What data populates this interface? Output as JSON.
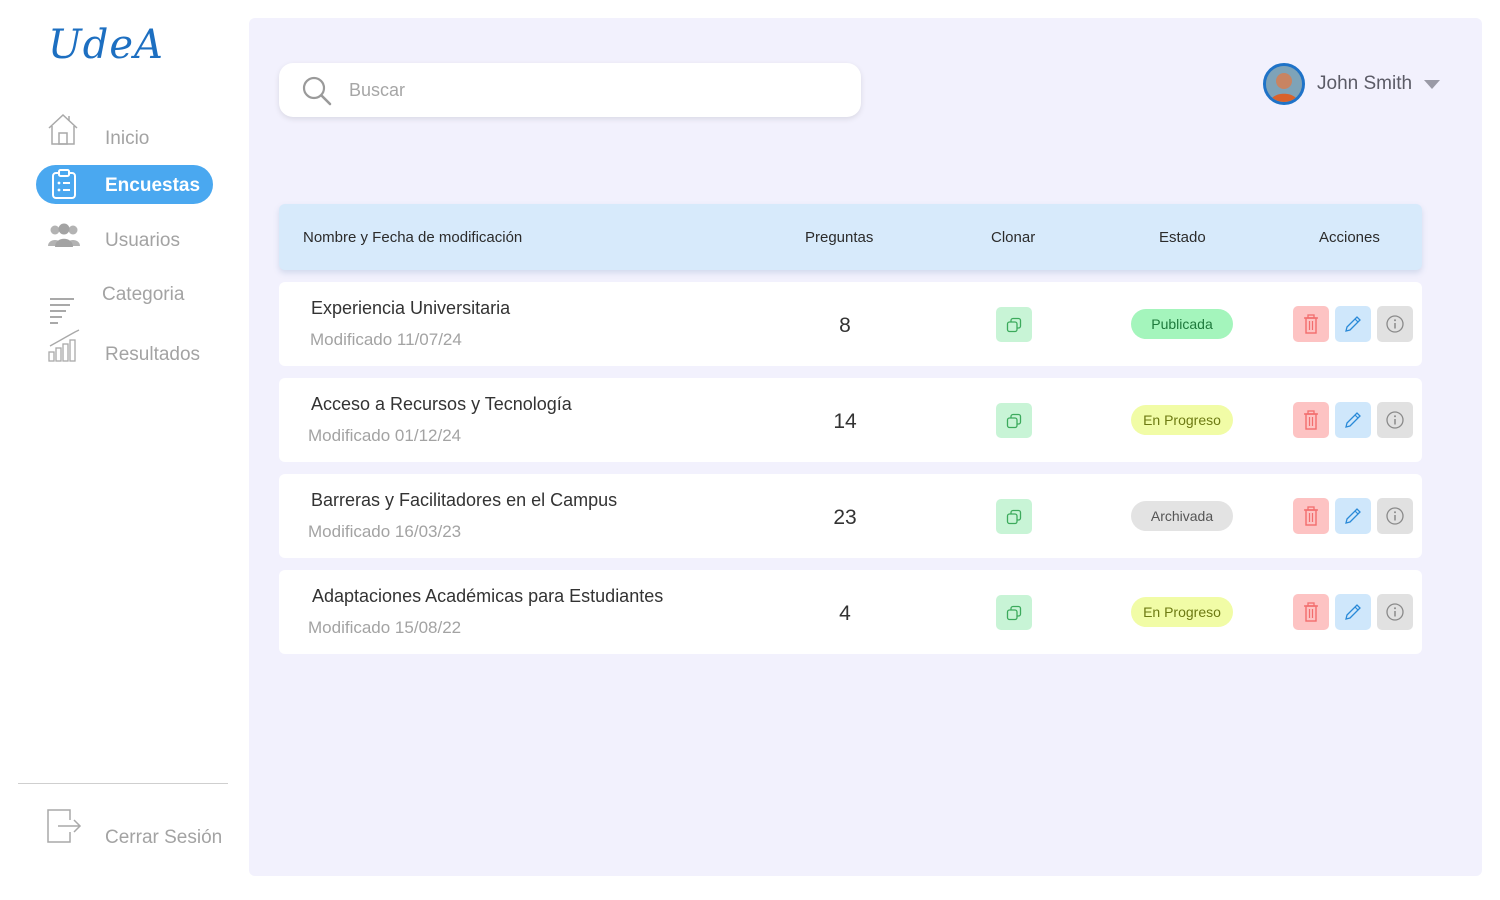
{
  "app": {
    "logo": "UdeA"
  },
  "sidebar": {
    "items": [
      {
        "label": "Inicio",
        "icon": "home-icon"
      },
      {
        "label": "Encuestas",
        "icon": "clipboard-icon",
        "active": true
      },
      {
        "label": "Usuarios",
        "icon": "users-icon"
      },
      {
        "label": "Categoria",
        "icon": "list-icon"
      },
      {
        "label": "Resultados",
        "icon": "bar-chart-icon"
      }
    ],
    "logout": {
      "label": "Cerrar Sesión",
      "icon": "logout-icon"
    }
  },
  "search": {
    "placeholder": "Buscar",
    "value": ""
  },
  "user": {
    "name": "John Smith"
  },
  "table": {
    "headers": [
      "Nombre y Fecha de modificación",
      "Preguntas",
      "Clonar",
      "Estado",
      "Acciones"
    ],
    "rows": [
      {
        "title": "Experiencia Universitaria",
        "modified": "Modificado 11/07/24",
        "questions": "8",
        "status": "Publicada"
      },
      {
        "title": "Acceso a Recursos y Tecnología",
        "modified": "Modificado 01/12/24",
        "questions": "14",
        "status": "En Progreso"
      },
      {
        "title": "Barreras y Facilitadores en el Campus",
        "modified": "Modificado 16/03/23",
        "questions": "23",
        "status": "Archivada"
      },
      {
        "title": "Adaptaciones Académicas para Estudiantes",
        "modified": "Modificado 15/08/22",
        "questions": "4",
        "status": "En Progreso"
      }
    ]
  },
  "colors": {
    "accent": "#4aa8f0",
    "panel_bg": "#f2f1fd",
    "header_bg": "#d7eafb",
    "status_published_bg": "#a4f5bc",
    "status_progress_bg": "#f1fca6",
    "status_archived_bg": "#e3e3e3"
  }
}
